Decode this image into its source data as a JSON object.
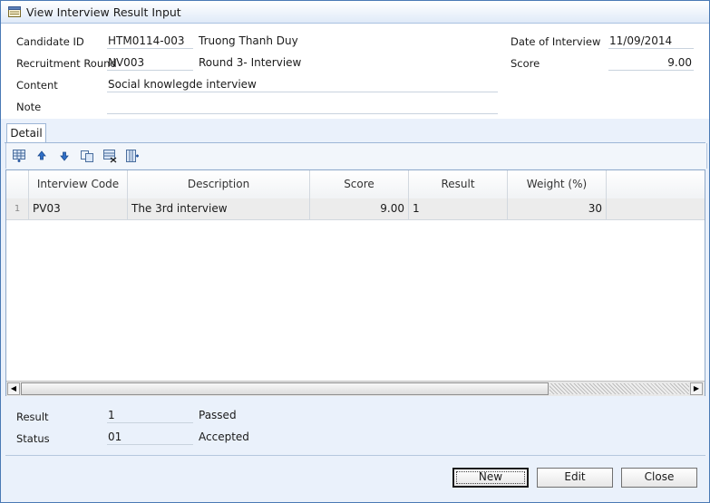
{
  "window": {
    "title": "View Interview Result Input"
  },
  "form": {
    "candidate_id": {
      "label": "Candidate ID",
      "value": "HTM0114-003",
      "name": "Truong Thanh Duy"
    },
    "recruitment_round": {
      "label": "Recruitment Round",
      "value": "NV003",
      "name": "Round 3- Interview"
    },
    "content": {
      "label": "Content",
      "value": "Social knowlegde interview"
    },
    "note": {
      "label": "Note",
      "value": ""
    },
    "date_of_interview": {
      "label": "Date of Interview",
      "value": "11/09/2014"
    },
    "score": {
      "label": "Score",
      "value": "9.00"
    }
  },
  "tabs": [
    {
      "label": "Detail",
      "active": true
    }
  ],
  "toolbar": {
    "icons": [
      "insert-row-icon",
      "move-up-icon",
      "move-down-icon",
      "copy-row-icon",
      "delete-row-icon",
      "insert-column-icon"
    ]
  },
  "grid": {
    "columns": [
      "",
      "Interview Code",
      "Description",
      "Score",
      "Result",
      "Weight (%)"
    ],
    "rows": [
      {
        "num": "1",
        "code": "PV03",
        "description": "The 3rd interview",
        "score": "9.00",
        "result": "1",
        "weight": "30"
      }
    ]
  },
  "result": {
    "label": "Result",
    "value": "1",
    "text": "Passed"
  },
  "status": {
    "label": "Status",
    "value": "01",
    "text": "Accepted"
  },
  "buttons": {
    "new": "New",
    "edit": "Edit",
    "close": "Close"
  },
  "colors": {
    "window_border": "#4a7ab5",
    "panel_bg": "#eaf1fb",
    "grid_border": "#8ea8c8",
    "row_bg": "#ececec"
  }
}
